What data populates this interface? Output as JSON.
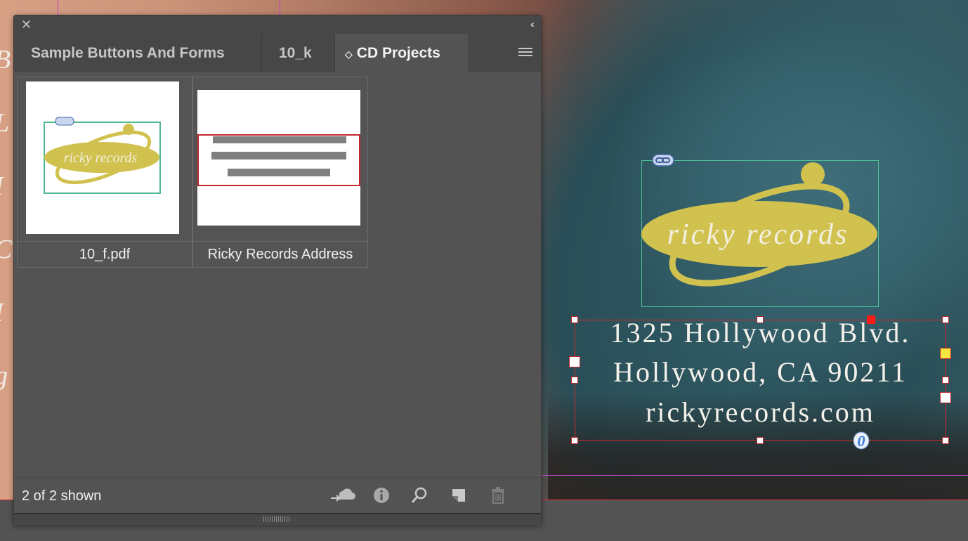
{
  "panel": {
    "tabs": [
      {
        "label": "Sample Buttons And Forms"
      },
      {
        "label": "10_k"
      },
      {
        "label": "CD Projects",
        "active": true
      }
    ],
    "items": [
      {
        "label": "10_f.pdf",
        "logo_text": "ricky records"
      },
      {
        "label": "Ricky Records Address"
      }
    ],
    "status": "2 of 2 shown",
    "icons": [
      "close-icon",
      "collapse-icon",
      "panel-menu-icon",
      "cloud-upload-icon",
      "info-icon",
      "search-icon",
      "new-item-icon",
      "trash-icon"
    ]
  },
  "canvas": {
    "logo_text": "ricky records",
    "address": {
      "line1": "1325 Hollywood Blvd.",
      "line2": "Hollywood, CA 90211",
      "line3": "rickyrecords.com"
    },
    "colors": {
      "logo_yellow": "#d1c24f",
      "frame_red": "#d12a2a",
      "frame_green": "#4fbf9a"
    }
  }
}
